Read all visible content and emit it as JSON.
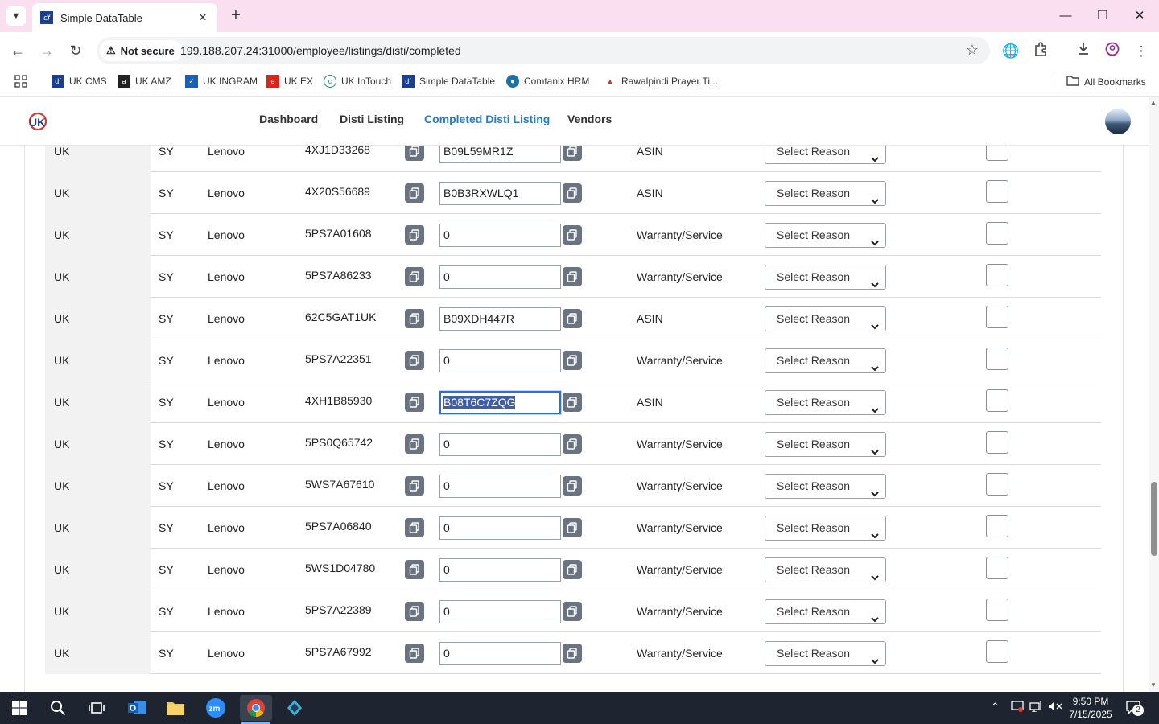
{
  "browser": {
    "tab_title": "Simple DataTable",
    "security_label": "Not secure",
    "url": "199.188.207.24:31000/employee/listings/disti/completed",
    "bookmarks": [
      "UK CMS",
      "UK AMZ",
      "UK INGRAM",
      "UK EX",
      "UK InTouch",
      "Simple DataTable",
      "Comtanix HRM",
      "Rawalpindi Prayer Ti..."
    ],
    "all_bookmarks": "All Bookmarks"
  },
  "nav": {
    "dashboard": "Dashboard",
    "disti_listing": "Disti Listing",
    "completed_disti_listing": "Completed Disti Listing",
    "vendors": "Vendors"
  },
  "rows": [
    {
      "country": "UK",
      "code": "SY",
      "brand": "Lenovo",
      "part": "4XJ1D33268",
      "value": "B09L59MR1Z",
      "type": "ASIN",
      "reason": "Select Reason"
    },
    {
      "country": "UK",
      "code": "SY",
      "brand": "Lenovo",
      "part": "4X20S56689",
      "value": "B0B3RXWLQ1",
      "type": "ASIN",
      "reason": "Select Reason"
    },
    {
      "country": "UK",
      "code": "SY",
      "brand": "Lenovo",
      "part": "5PS7A01608",
      "value": "0",
      "type": "Warranty/Service",
      "reason": "Select Reason"
    },
    {
      "country": "UK",
      "code": "SY",
      "brand": "Lenovo",
      "part": "5PS7A86233",
      "value": "0",
      "type": "Warranty/Service",
      "reason": "Select Reason"
    },
    {
      "country": "UK",
      "code": "SY",
      "brand": "Lenovo",
      "part": "62C5GAT1UK",
      "value": "B09XDH447R",
      "type": "ASIN",
      "reason": "Select Reason"
    },
    {
      "country": "UK",
      "code": "SY",
      "brand": "Lenovo",
      "part": "5PS7A22351",
      "value": "0",
      "type": "Warranty/Service",
      "reason": "Select Reason"
    },
    {
      "country": "UK",
      "code": "SY",
      "brand": "Lenovo",
      "part": "4XH1B85930",
      "value": "B08T6C7ZQG",
      "type": "ASIN",
      "reason": "Select Reason"
    },
    {
      "country": "UK",
      "code": "SY",
      "brand": "Lenovo",
      "part": "5PS0Q65742",
      "value": "0",
      "type": "Warranty/Service",
      "reason": "Select Reason"
    },
    {
      "country": "UK",
      "code": "SY",
      "brand": "Lenovo",
      "part": "5WS7A67610",
      "value": "0",
      "type": "Warranty/Service",
      "reason": "Select Reason"
    },
    {
      "country": "UK",
      "code": "SY",
      "brand": "Lenovo",
      "part": "5PS7A06840",
      "value": "0",
      "type": "Warranty/Service",
      "reason": "Select Reason"
    },
    {
      "country": "UK",
      "code": "SY",
      "brand": "Lenovo",
      "part": "5WS1D04780",
      "value": "0",
      "type": "Warranty/Service",
      "reason": "Select Reason"
    },
    {
      "country": "UK",
      "code": "SY",
      "brand": "Lenovo",
      "part": "5PS7A22389",
      "value": "0",
      "type": "Warranty/Service",
      "reason": "Select Reason"
    },
    {
      "country": "UK",
      "code": "SY",
      "brand": "Lenovo",
      "part": "5PS7A67992",
      "value": "0",
      "type": "Warranty/Service",
      "reason": "Select Reason"
    }
  ],
  "focused_row": 6,
  "taskbar": {
    "time": "9:50 PM",
    "date": "7/15/2025",
    "notification_count": "2"
  }
}
